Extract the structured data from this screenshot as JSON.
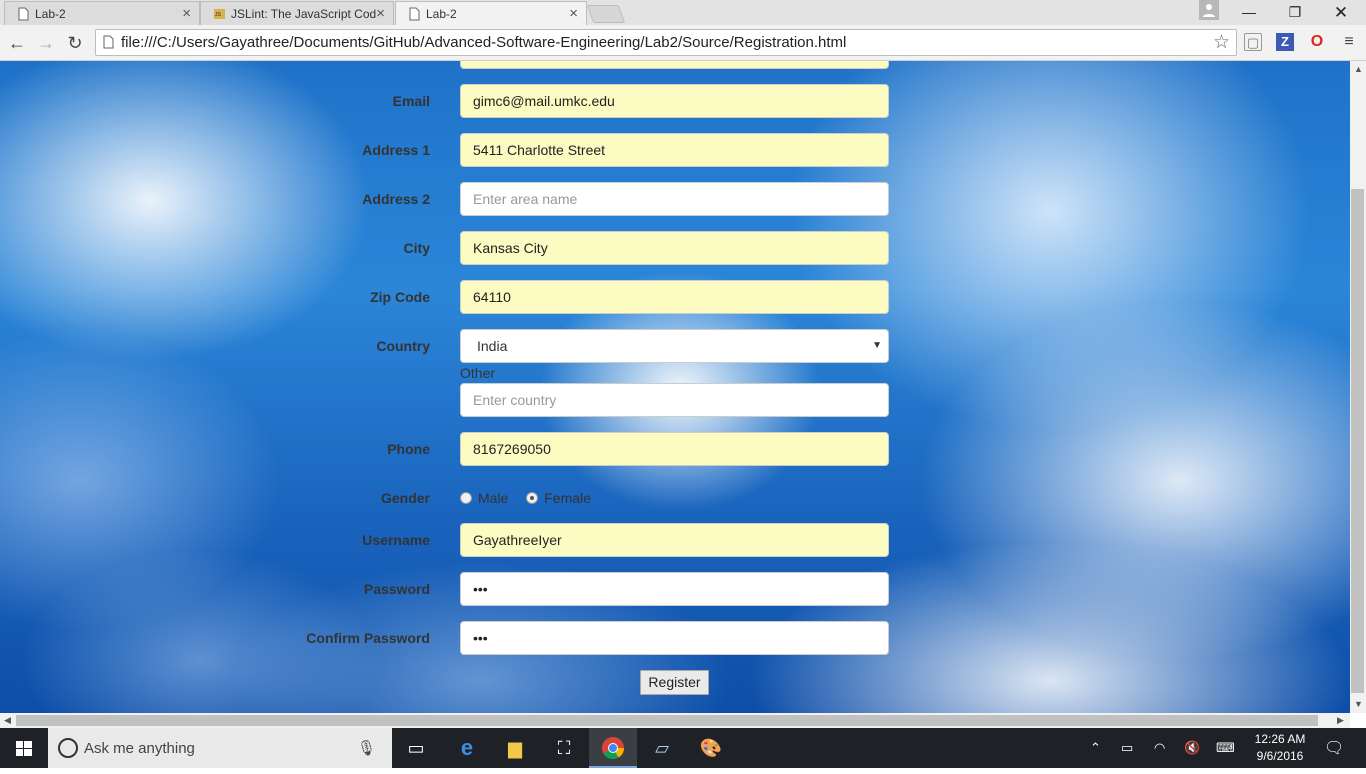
{
  "browser": {
    "tabs": [
      {
        "title": "Lab-2",
        "active": false
      },
      {
        "title": "JSLint: The JavaScript Cod",
        "active": false
      },
      {
        "title": "Lab-2",
        "active": true
      }
    ],
    "url": "file:///C:/Users/Gayathree/Documents/GitHub/Advanced-Software-Engineering/Lab2/Source/Registration.html"
  },
  "form": {
    "email": {
      "label": "Email",
      "value": "gimc6@mail.umkc.edu"
    },
    "address1": {
      "label": "Address 1",
      "value": "5411 Charlotte Street"
    },
    "address2": {
      "label": "Address 2",
      "placeholder": "Enter area name"
    },
    "city": {
      "label": "City",
      "value": "Kansas City"
    },
    "zip": {
      "label": "Zip Code",
      "value": "64110"
    },
    "country": {
      "label": "Country",
      "selected": "India"
    },
    "other": {
      "label": "Other",
      "placeholder": "Enter country"
    },
    "phone": {
      "label": "Phone",
      "value": "8167269050"
    },
    "gender": {
      "label": "Gender",
      "options": [
        "Male",
        "Female"
      ],
      "selected": "Female"
    },
    "username": {
      "label": "Username",
      "value": "GayathreeIyer"
    },
    "password": {
      "label": "Password",
      "value": "•••"
    },
    "confirm_password": {
      "label": "Confirm Password",
      "value": "•••"
    },
    "register_label": "Register"
  },
  "taskbar": {
    "search_placeholder": "Ask me anything",
    "time": "12:26 AM",
    "date": "9/6/2016"
  }
}
